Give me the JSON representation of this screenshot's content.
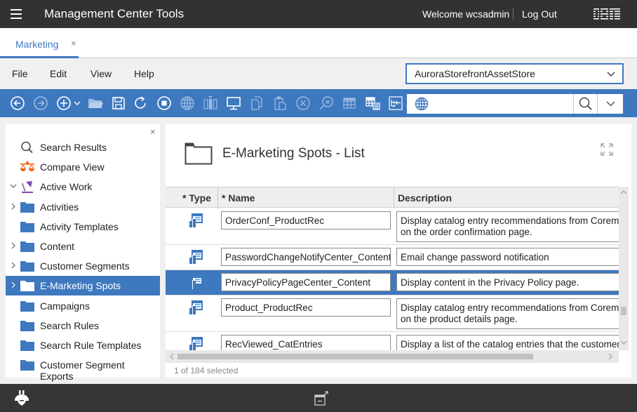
{
  "header": {
    "app_title": "Management Center Tools",
    "welcome": "Welcome wcsadmin",
    "logout": "Log Out",
    "brand": "IBM"
  },
  "tabs": [
    {
      "label": "Marketing",
      "active": true,
      "close": "×"
    }
  ],
  "menu": {
    "items": [
      "File",
      "Edit",
      "View",
      "Help"
    ],
    "store_selector": {
      "value": "AuroraStorefrontAssetStore"
    }
  },
  "toolbar": {
    "icons": [
      "back-icon",
      "forward-icon",
      "new-icon",
      "new-dropdown-icon",
      "open-folder-icon",
      "save-icon",
      "refresh-icon",
      "stop-icon",
      "globe-icon",
      "split-view-icon",
      "monitor-icon",
      "copy-icon",
      "paste-icon",
      "delete-icon",
      "find-icon",
      "table-icon",
      "table-list-icon",
      "tree-back-icon"
    ],
    "search": {
      "value": "",
      "placeholder": ""
    }
  },
  "sidebar": {
    "close": "×",
    "items": [
      {
        "label": "Search Results",
        "icon": "search-icon",
        "expander": "none"
      },
      {
        "label": "Compare View",
        "icon": "scales-icon",
        "expander": "none"
      },
      {
        "label": "Active Work",
        "icon": "lamp-icon",
        "expander": "expanded"
      },
      {
        "label": "Activities",
        "icon": "folder-icon",
        "expander": "collapsed"
      },
      {
        "label": "Activity Templates",
        "icon": "folder-icon",
        "expander": "none"
      },
      {
        "label": "Content",
        "icon": "folder-icon",
        "expander": "collapsed"
      },
      {
        "label": "Customer Segments",
        "icon": "folder-icon",
        "expander": "collapsed"
      },
      {
        "label": "E-Marketing Spots",
        "icon": "folder-icon",
        "expander": "collapsed",
        "selected": true
      },
      {
        "label": "Campaigns",
        "icon": "folder-icon",
        "expander": "none"
      },
      {
        "label": "Search Rules",
        "icon": "folder-icon",
        "expander": "none"
      },
      {
        "label": "Search Rule Templates",
        "icon": "folder-icon",
        "expander": "none"
      },
      {
        "label": "Customer Segment Exports",
        "icon": "folder-icon",
        "expander": "none"
      }
    ]
  },
  "main": {
    "title": "E-Marketing Spots - List",
    "columns": [
      "* Type",
      "* Name",
      "Description"
    ],
    "rows": [
      {
        "type": "e-marketing-spot",
        "name": "OrderConf_ProductRec",
        "description": [
          "Display catalog entry recommendations from Coremet",
          "on the order confirmation page."
        ]
      },
      {
        "type": "e-marketing-spot",
        "name": "PasswordChangeNotifyCenter_Content",
        "description": [
          "Email change password notification"
        ]
      },
      {
        "type": "e-marketing-spot",
        "name": "PrivacyPolicyPageCenter_Content",
        "description": [
          "Display content in the Privacy Policy page."
        ],
        "selected": true
      },
      {
        "type": "e-marketing-spot",
        "name": "Product_ProductRec",
        "description": [
          "Display catalog entry recommendations from Coremet",
          "on the product details page."
        ]
      },
      {
        "type": "e-marketing-spot",
        "name": "RecViewed_CatEntries",
        "description": [
          "Display a list of the catalog entries that the customer"
        ]
      }
    ],
    "status": "1 of 184 selected"
  },
  "colors": {
    "accent": "#3e78bf",
    "topbar": "#323232",
    "footer": "#363636",
    "compare_icon": "#f0630f",
    "lamp_icon": "#7f4aa6"
  }
}
